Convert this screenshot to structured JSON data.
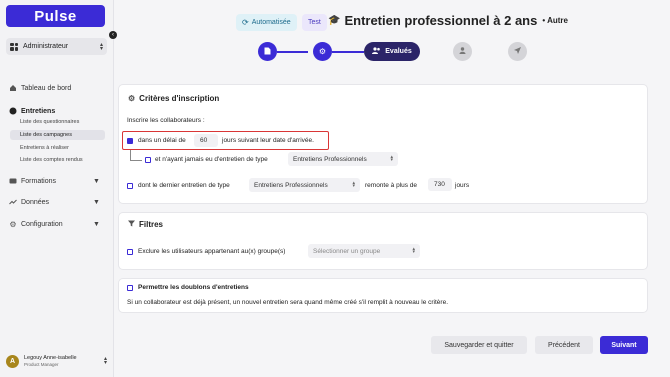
{
  "sidebar": {
    "logo": "Pulse",
    "role": "Administrateur",
    "nav": {
      "dashboard": "Tableau de bord",
      "interviews": "Entretiens",
      "interviews_sub": [
        "Liste des questionnaires",
        "Liste des campagnes",
        "Entretiens à réaliser",
        "Liste des comptes rendus"
      ],
      "trainings": "Formations",
      "data": "Données",
      "config": "Configuration"
    },
    "user": {
      "initial": "A",
      "name": "Legouy Anne-isabelle",
      "role": "Product Manager"
    }
  },
  "header": {
    "badge_auto": "Automatisée",
    "badge_test": "Test",
    "title": "Entretien professionnel à 2 ans",
    "subtitle": "• Autre"
  },
  "stepper": {
    "active_label": "Evalués",
    "steps": [
      {
        "icon": "document-icon",
        "state": "done"
      },
      {
        "icon": "gear-icon",
        "state": "done"
      },
      {
        "icon": "users-icon",
        "state": "active"
      },
      {
        "icon": "user-icon",
        "state": "todo"
      },
      {
        "icon": "send-icon",
        "state": "todo"
      }
    ]
  },
  "criteria": {
    "title": "Critères d'inscription",
    "intro": "Inscrire les collaborateurs :",
    "opt1_before": "dans un délai de",
    "opt1_value": "60",
    "opt1_after": "jours suivant leur date d'arrivée.",
    "opt2_label": "et n'ayant jamais eu d'entretien de type",
    "opt2_select": "Entretiens Professionnels",
    "opt3_label": "dont le dernier entretien de type",
    "opt3_select": "Entretiens Professionnels",
    "opt3_mid": "remonte à plus de",
    "opt3_value": "730",
    "opt3_unit": "jours"
  },
  "filters": {
    "title": "Filtres",
    "exclude_label": "Exclure les utilisateurs appartenant au(x) groupe(s)",
    "group_placeholder": "Sélectionner un groupe"
  },
  "duplicates": {
    "label": "Permettre les doublons d'entretiens",
    "note": "Si un collaborateur est déjà présent, un nouvel entretien sera quand même créé s'il remplit à nouveau le critère."
  },
  "footer": {
    "save_quit": "Sauvegarder et quitter",
    "previous": "Précédent",
    "next": "Suivant"
  },
  "colors": {
    "brand": "#3b2bd6",
    "highlight": "#d93636"
  }
}
